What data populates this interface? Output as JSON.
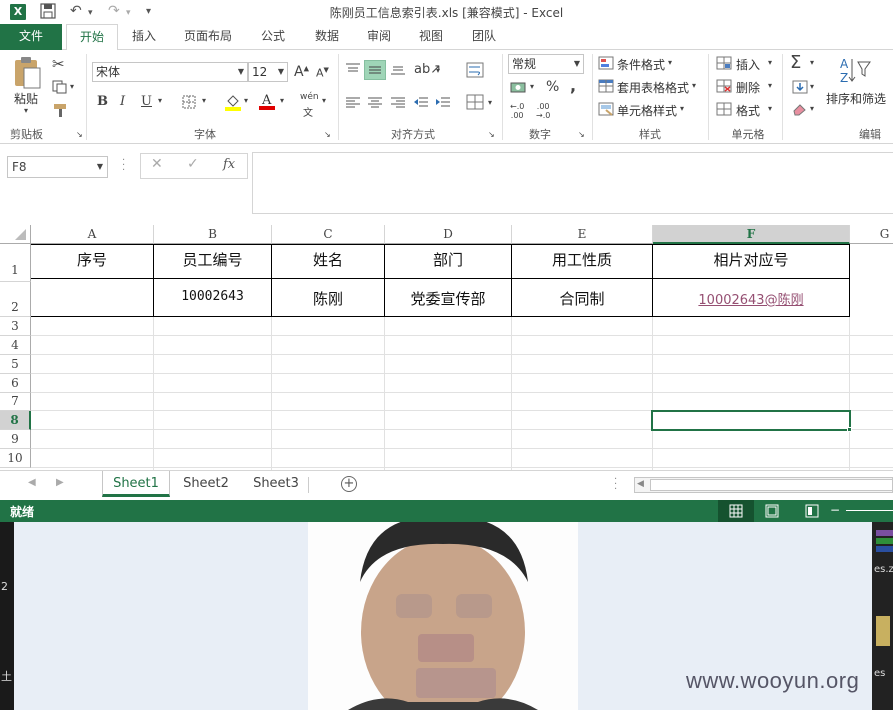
{
  "app": {
    "logo_letter": "X",
    "title": "陈刚员工信息索引表.xls  [兼容模式] - Excel"
  },
  "tabs": [
    "文件",
    "开始",
    "插入",
    "页面布局",
    "公式",
    "数据",
    "审阅",
    "视图",
    "团队"
  ],
  "ribbon": {
    "clipboard": {
      "paste": "粘贴",
      "label": "剪贴板"
    },
    "font": {
      "name": "宋体",
      "size": "12",
      "label": "字体",
      "bold": "B",
      "italic": "I",
      "underline": "U",
      "wen": "wén"
    },
    "alignment": {
      "label": "对齐方式"
    },
    "number": {
      "format": "常规",
      "label": "数字",
      "percent": "%",
      "comma": ","
    },
    "styles": {
      "cond": "条件格式",
      "table": "套用表格格式",
      "cell": "单元格样式",
      "label": "样式"
    },
    "cells": {
      "insert": "插入",
      "delete": "删除",
      "format": "格式",
      "label": "单元格"
    },
    "editing": {
      "sort": "排序和筛选",
      "label": "编辑",
      "sigma": "Σ"
    }
  },
  "formula_bar": {
    "name_box": "F8",
    "fx": "fx",
    "cancel": "✕",
    "confirm": "✓",
    "content": ""
  },
  "columns": [
    "A",
    "B",
    "C",
    "D",
    "E",
    "F",
    "G"
  ],
  "rows": [
    "1",
    "2",
    "3",
    "4",
    "5",
    "6",
    "7",
    "8",
    "9",
    "10"
  ],
  "table": {
    "headers": [
      "序号",
      "员工编号",
      "姓名",
      "部门",
      "用工性质",
      "相片对应号"
    ],
    "row2": [
      "",
      "10002643",
      "陈刚",
      "党委宣传部",
      "合同制",
      "10002643@陈刚"
    ]
  },
  "sheets": [
    "Sheet1",
    "Sheet2",
    "Sheet3"
  ],
  "status": {
    "ready": "就绪"
  },
  "watermark": "www.wooyun.org",
  "side_text": {
    "left1": "2",
    "left2": "土",
    "right1": "es.z",
    "right2": "es"
  },
  "colors": {
    "excel_green": "#217346",
    "link": "#954f72"
  }
}
